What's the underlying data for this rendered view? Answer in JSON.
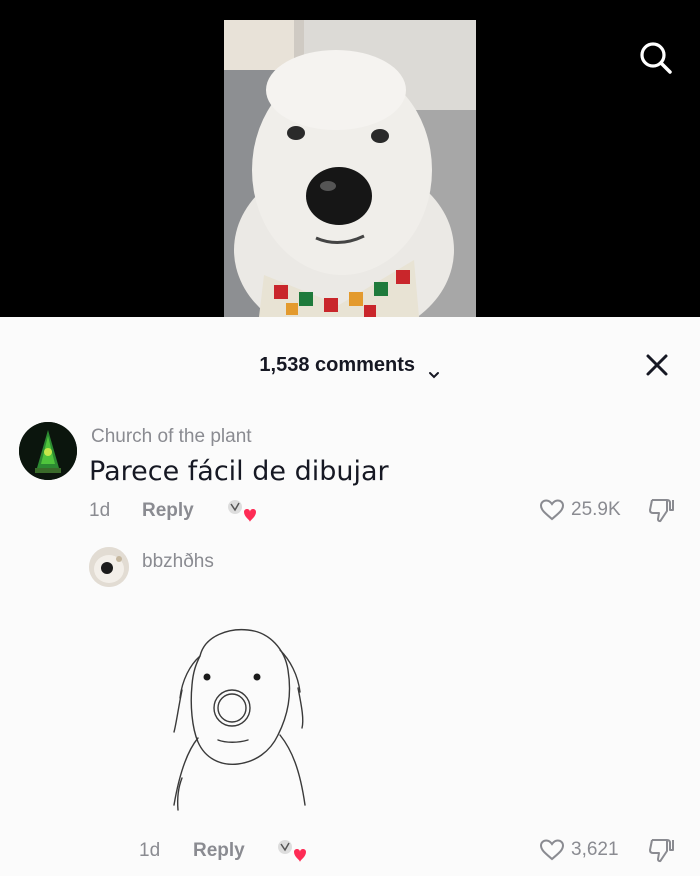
{
  "video": {
    "search_icon": "search-icon"
  },
  "comments_panel": {
    "title": "1,538 comments",
    "close_icon": "close-icon"
  },
  "comments": [
    {
      "username": "Church of the plant",
      "text": "Parece fácil de dibujar",
      "time": "1d",
      "reply_label": "Reply",
      "like_count": "25.9K"
    },
    {
      "username": "bbzhðhs",
      "time": "1d",
      "reply_label": "Reply",
      "like_count": "3,621"
    }
  ],
  "colors": {
    "text_primary": "#161823",
    "text_secondary": "#8a8b91",
    "heart_red": "#fe2c55"
  }
}
